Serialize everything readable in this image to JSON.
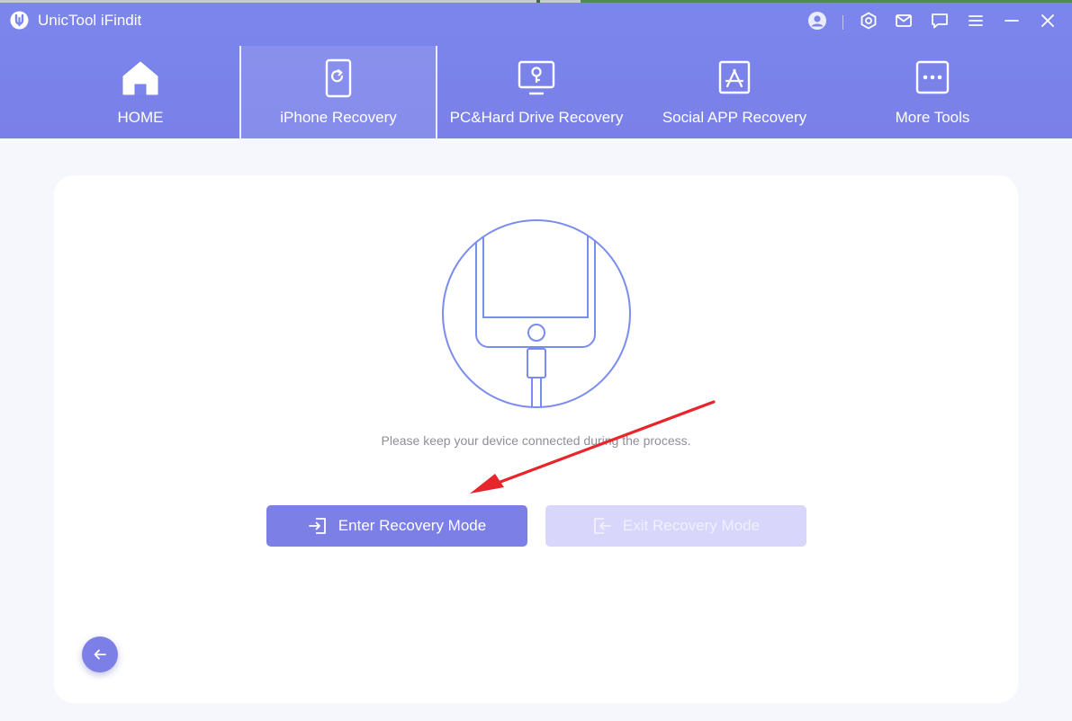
{
  "app": {
    "title": "UnicTool iFindit"
  },
  "toolbar": {
    "icons": [
      "account-icon",
      "settings-icon",
      "mail-icon",
      "feedback-icon",
      "menu-icon",
      "minimize-icon",
      "close-icon"
    ]
  },
  "nav": {
    "tabs": [
      {
        "label": "HOME",
        "icon": "home-icon"
      },
      {
        "label": "iPhone Recovery",
        "icon": "iphone-refresh-icon",
        "active": true
      },
      {
        "label": "PC&Hard Drive Recovery",
        "icon": "pc-drive-icon"
      },
      {
        "label": "Social APP Recovery",
        "icon": "app-store-icon"
      },
      {
        "label": "More Tools",
        "icon": "more-tools-icon"
      }
    ]
  },
  "main": {
    "hint": "Please keep your device connected during the process.",
    "enter_label": "Enter Recovery Mode",
    "exit_label": "Exit Recovery Mode"
  },
  "colors": {
    "header": "#7b86ec",
    "accent": "#7b7fe6",
    "disabled": "#d8d6fb",
    "illustration": "#7b8cf0",
    "annotation_arrow": "#e8252a"
  }
}
